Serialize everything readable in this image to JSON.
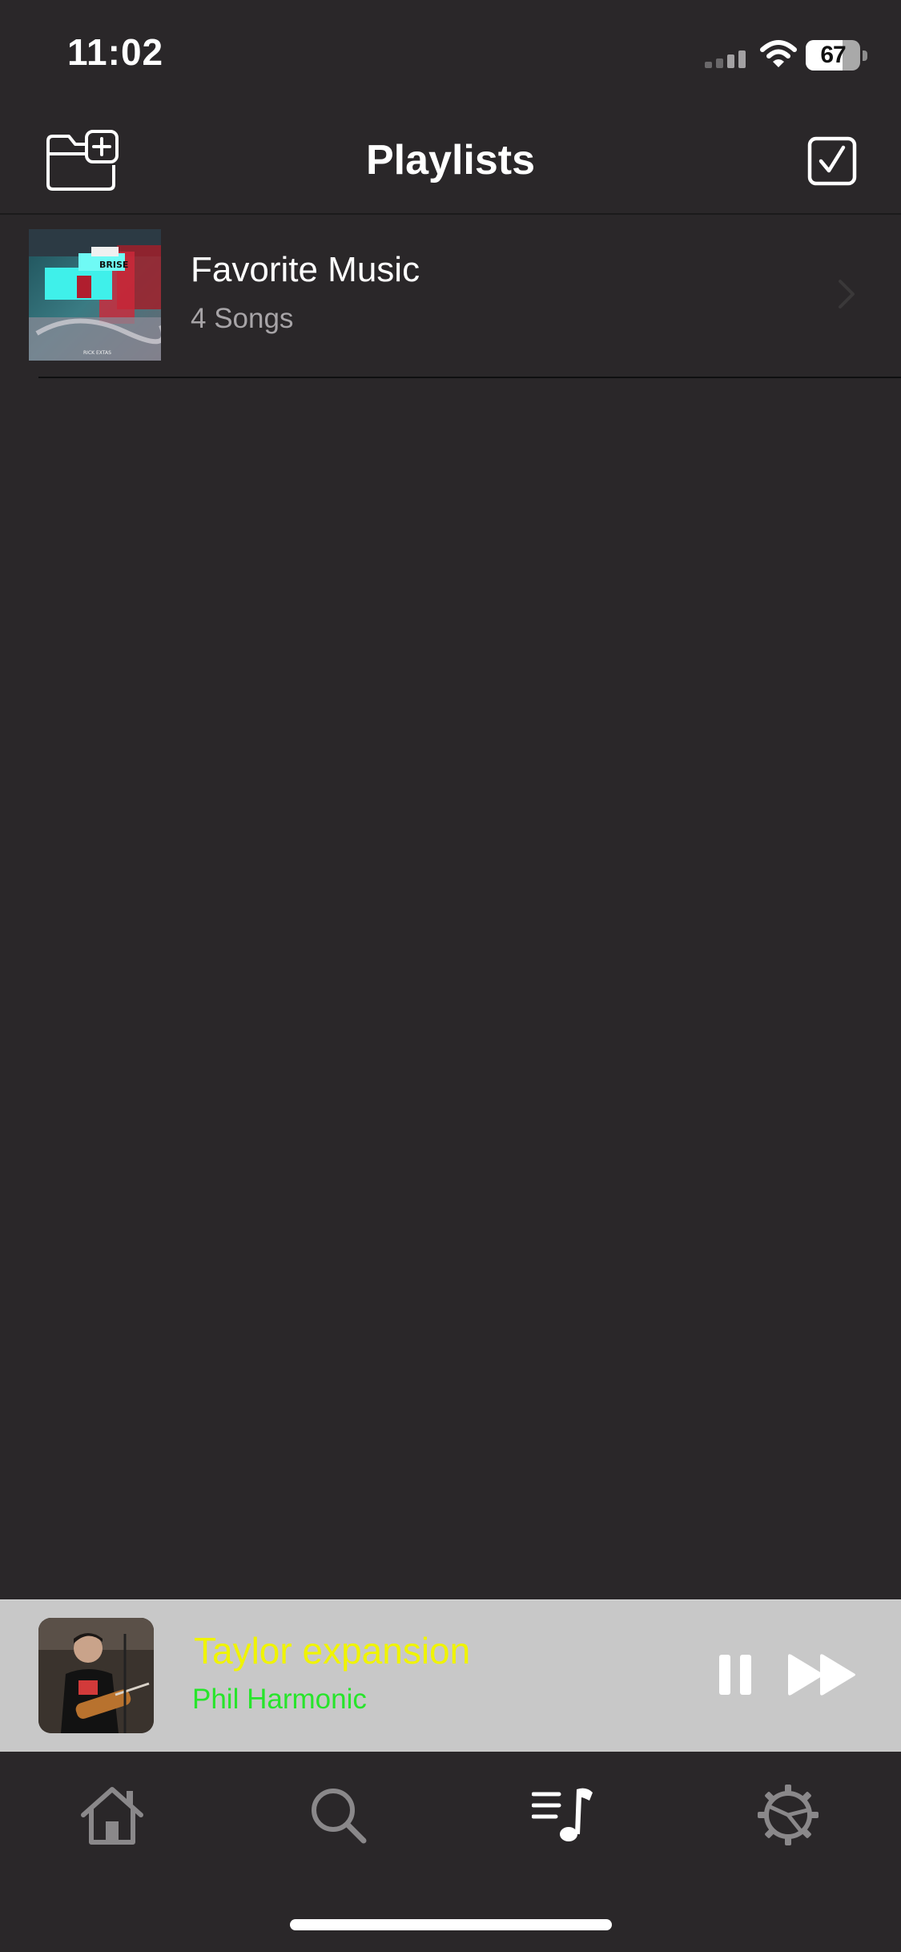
{
  "status_bar": {
    "time": "11:02",
    "battery_level": "67",
    "icons": [
      "cellular-signal-icon",
      "wifi-icon",
      "battery-icon"
    ]
  },
  "nav": {
    "title": "Playlists",
    "left_icon": "new-folder-icon",
    "right_icon": "select-checkbox-icon"
  },
  "playlists": [
    {
      "name": "Favorite Music",
      "count": "4 Songs",
      "artwork_caption": "RICK EXTAS",
      "artwork_title": "BRISE"
    }
  ],
  "now_playing": {
    "title": "Taylor expansion",
    "artist": "Phil Harmonic",
    "state": "playing",
    "controls": [
      "pause-icon",
      "fast-forward-icon"
    ]
  },
  "tab_bar": {
    "tabs": [
      {
        "icon": "home-icon",
        "selected": false
      },
      {
        "icon": "search-icon",
        "selected": false
      },
      {
        "icon": "playlist-icon",
        "selected": true
      },
      {
        "icon": "settings-gear-icon",
        "selected": false
      }
    ]
  },
  "colors": {
    "background": "#2a2729",
    "mini_player_bg": "#c8c8c8",
    "now_playing_title": "#f0f400",
    "now_playing_artist": "#27e52b",
    "tab_inactive": "#8a888a",
    "tab_active": "#ffffff",
    "secondary_text": "#a7a4a7"
  }
}
